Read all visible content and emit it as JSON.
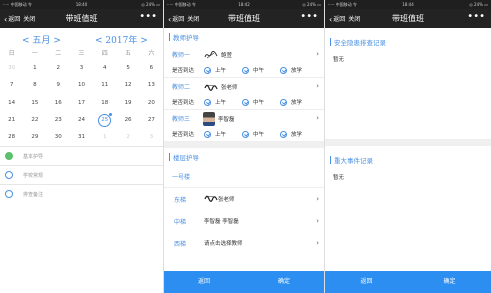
{
  "screens": [
    {
      "status": {
        "carrier": "····· 中国移动 令",
        "time": "18:40",
        "battery": "◎ 24% ▭"
      },
      "nav": {
        "back": "返回",
        "close": "关闭",
        "title": "带班值班",
        "more": "•••"
      }
    },
    {
      "status": {
        "carrier": "····· 中国移动 令",
        "time": "18:42",
        "battery": "◎ 24% ▭"
      },
      "nav": {
        "back": "返回",
        "close": "关闭",
        "title": "带班值班",
        "more": "•••"
      }
    },
    {
      "status": {
        "carrier": "····· 中国移动 令",
        "time": "18:44",
        "battery": "◎ 24% ▭"
      },
      "nav": {
        "back": "返回",
        "close": "关闭",
        "title": "带班值班",
        "more": "•••"
      }
    }
  ],
  "calendar": {
    "month": "五月",
    "year": "2017年",
    "prev": "<",
    "next": ">",
    "weekdays": [
      "日",
      "一",
      "二",
      "三",
      "四",
      "五",
      "六"
    ],
    "days": [
      {
        "d": "30",
        "dim": true
      },
      {
        "d": "1"
      },
      {
        "d": "2"
      },
      {
        "d": "3"
      },
      {
        "d": "4"
      },
      {
        "d": "5"
      },
      {
        "d": "6"
      },
      {
        "d": "7"
      },
      {
        "d": "8"
      },
      {
        "d": "9"
      },
      {
        "d": "10"
      },
      {
        "d": "11"
      },
      {
        "d": "12"
      },
      {
        "d": "13"
      },
      {
        "d": "14"
      },
      {
        "d": "15"
      },
      {
        "d": "16"
      },
      {
        "d": "17"
      },
      {
        "d": "18"
      },
      {
        "d": "19"
      },
      {
        "d": "20"
      },
      {
        "d": "21"
      },
      {
        "d": "22"
      },
      {
        "d": "23"
      },
      {
        "d": "24"
      },
      {
        "d": "25",
        "today": true
      },
      {
        "d": "26"
      },
      {
        "d": "27"
      },
      {
        "d": "28"
      },
      {
        "d": "29"
      },
      {
        "d": "30"
      },
      {
        "d": "31"
      },
      {
        "d": "1",
        "dim": true
      },
      {
        "d": "2",
        "dim": true
      },
      {
        "d": "3",
        "dim": true
      }
    ],
    "legend": [
      "基本护导",
      "学校常规",
      "排查备注"
    ],
    "legend_colors": [
      "#5cc16b",
      "#4a90e2"
    ]
  },
  "teacher_section": {
    "title": "教师护导",
    "arrive_label": "是否到达",
    "slots": [
      "上午",
      "中午",
      "放学"
    ],
    "teachers": [
      {
        "name": "教师一",
        "person": "鲍萱",
        "kind": "sig"
      },
      {
        "name": "教师二",
        "person": "张老师",
        "kind": "sig2"
      },
      {
        "name": "教师三",
        "person": "李智磊",
        "kind": "avatar"
      }
    ]
  },
  "floor_section": {
    "title": "楼层护导",
    "building": "一号楼",
    "floors": [
      {
        "name": "东梯",
        "person": "张老师",
        "kind": "sig2"
      },
      {
        "name": "中梯",
        "person": "李智磊 李智磊",
        "kind": "avatar"
      },
      {
        "name": "西梯",
        "person": "请点击选择教师",
        "kind": "grey"
      }
    ]
  },
  "bottom": {
    "back": "返回",
    "confirm": "确定"
  },
  "safety": {
    "title": "安全隐患排查记录",
    "empty": "暂无"
  },
  "incident": {
    "title": "重大事件记录",
    "empty": "暂无"
  }
}
